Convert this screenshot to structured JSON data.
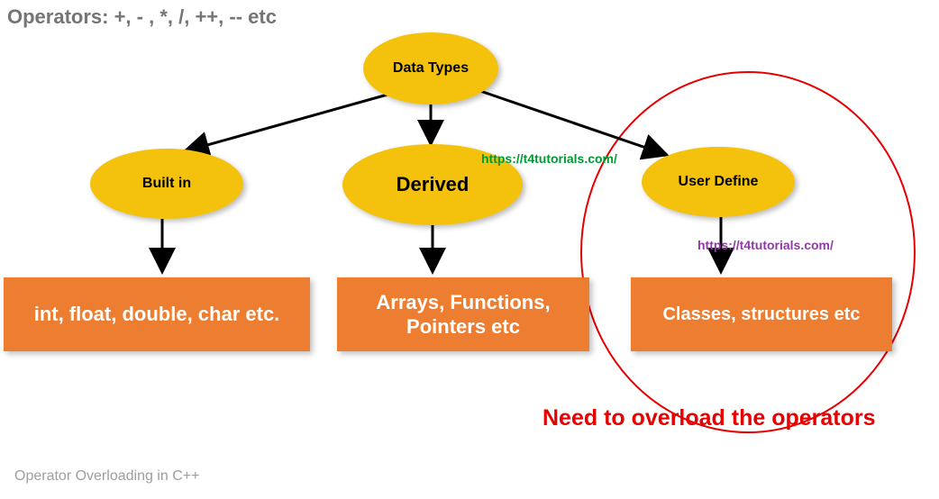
{
  "title_top": "Operators: +, - , *, /, ++, -- etc",
  "caption_bottom": "Operator Overloading in C++",
  "root": {
    "label": "Data Types"
  },
  "branches": {
    "built_in": {
      "label": "Built in",
      "box": "int, float, double, char etc."
    },
    "derived": {
      "label": "Derived",
      "box": "Arrays, Functions, Pointers etc"
    },
    "user_define": {
      "label": "User Define",
      "box": "Classes, structures etc"
    }
  },
  "watermarks": {
    "green": "https://t4tutorials.com/",
    "purple": "https://t4tutorials.com/"
  },
  "annotation": "Need to overload the operators",
  "colors": {
    "ellipse": "#f4c20d",
    "box": "#ed7d31",
    "highlight_red": "#e60000"
  }
}
